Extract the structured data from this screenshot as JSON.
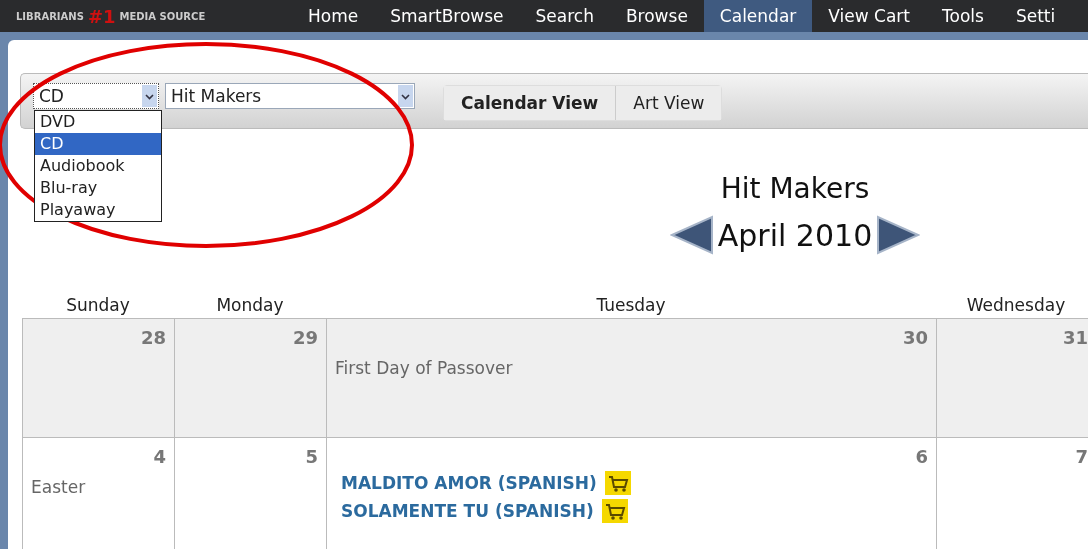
{
  "logo": {
    "left": "LIBRARIANS",
    "badge": "#1",
    "right": "MEDIA SOURCE"
  },
  "nav": [
    {
      "label": "Home",
      "selected": false
    },
    {
      "label": "SmartBrowse",
      "selected": false
    },
    {
      "label": "Search",
      "selected": false
    },
    {
      "label": "Browse",
      "selected": false
    },
    {
      "label": "Calendar",
      "selected": true
    },
    {
      "label": "View Cart",
      "selected": false
    },
    {
      "label": "Tools",
      "selected": false
    },
    {
      "label": "Setti",
      "selected": false
    }
  ],
  "format_select": {
    "value": "CD",
    "expanded": true,
    "options": [
      {
        "label": "DVD",
        "selected": false
      },
      {
        "label": "CD",
        "selected": true
      },
      {
        "label": "Audiobook",
        "selected": false
      },
      {
        "label": "Blu-ray",
        "selected": false
      },
      {
        "label": "Playaway",
        "selected": false
      }
    ]
  },
  "list_select": {
    "value": "Hit Makers"
  },
  "view_tabs": [
    {
      "label": "Calendar View",
      "selected": true
    },
    {
      "label": "Art View",
      "selected": false
    }
  ],
  "calendar": {
    "title": "Hit Makers",
    "month": "April 2010",
    "weekdays": [
      "Sunday",
      "Monday",
      "Tuesday",
      "Wednesday"
    ],
    "weeks": [
      {
        "days": [
          {
            "number": "28",
            "in_month": false
          },
          {
            "number": "29",
            "in_month": false
          },
          {
            "number": "30",
            "in_month": false,
            "events": [
              {
                "kind": "holiday",
                "text": "First Day of Passover"
              }
            ]
          },
          {
            "number": "31",
            "in_month": false
          }
        ]
      },
      {
        "days": [
          {
            "number": "4",
            "in_month": true,
            "events": [
              {
                "kind": "holiday",
                "text": "Easter"
              }
            ]
          },
          {
            "number": "5",
            "in_month": true
          },
          {
            "number": "6",
            "in_month": true,
            "events": [
              {
                "kind": "title",
                "text": "MALDITO AMOR (SPANISH)"
              },
              {
                "kind": "title",
                "text": "SOLAMENTE TU (SPANISH)"
              }
            ]
          },
          {
            "number": "7",
            "in_month": true
          }
        ]
      }
    ]
  }
}
